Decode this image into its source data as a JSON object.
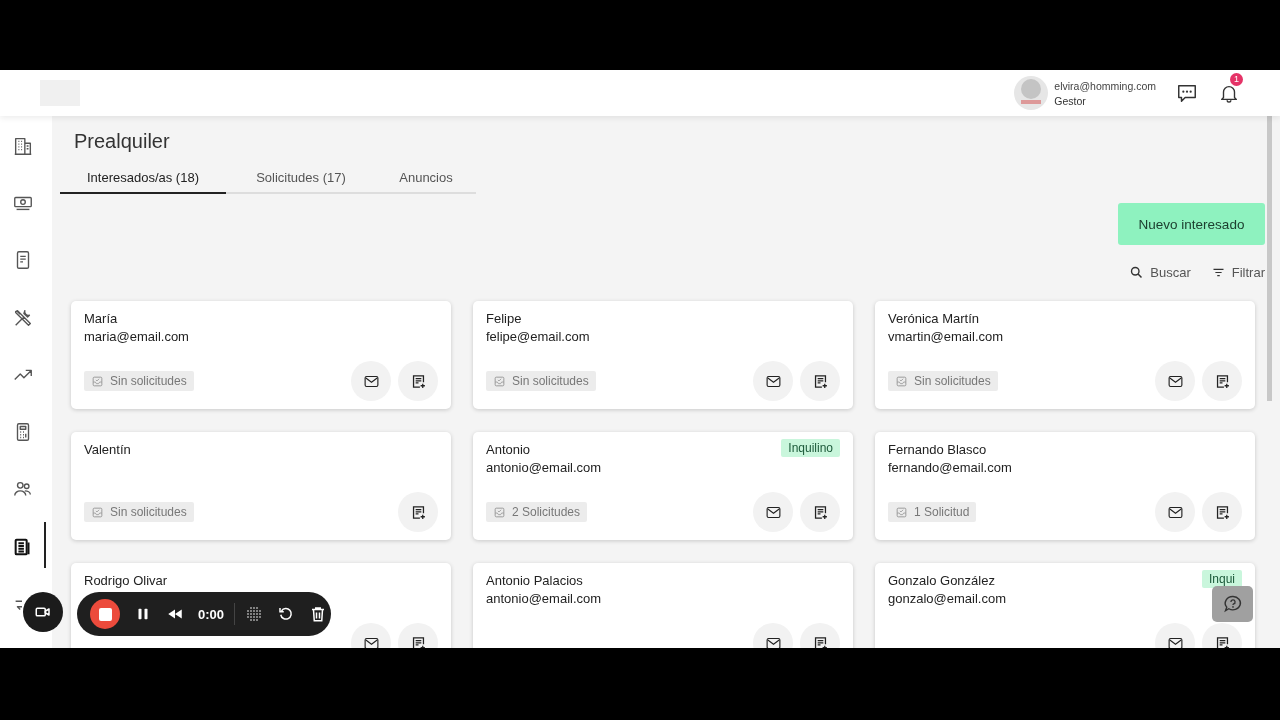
{
  "header": {
    "user_email": "elvira@homming.com",
    "user_role": "Gestor",
    "notification_count": "1"
  },
  "sidebar": {
    "items": [
      {
        "selected": false
      },
      {
        "selected": false
      },
      {
        "selected": false
      },
      {
        "selected": false
      },
      {
        "selected": false
      },
      {
        "selected": false
      },
      {
        "selected": false
      },
      {
        "selected": true
      },
      {
        "selected": false
      }
    ]
  },
  "page": {
    "title": "Prealquiler"
  },
  "tabs": [
    {
      "label": "Interesados/as (18)",
      "selected": true
    },
    {
      "label": "Solicitudes (17)",
      "selected": false
    },
    {
      "label": "Anuncios",
      "selected": false
    }
  ],
  "primary_button": "Nuevo interesado",
  "tools": {
    "search": "Buscar",
    "filter": "Filtrar"
  },
  "cards": [
    {
      "name": "María",
      "email": "maria@email.com",
      "requests": "Sin solicitudes",
      "can_email": true
    },
    {
      "name": "Felipe",
      "email": "felipe@email.com",
      "requests": "Sin solicitudes",
      "can_email": true
    },
    {
      "name": "Verónica Martín",
      "email": "vmartin@email.com",
      "requests": "Sin solicitudes",
      "can_email": true
    },
    {
      "name": "Valentín",
      "requests": "Sin solicitudes",
      "can_email": false
    },
    {
      "name": "Antonio",
      "email": "antonio@email.com",
      "tag": "Inquilino",
      "requests": "2 Solicitudes",
      "can_email": true
    },
    {
      "name": "Fernando Blasco",
      "email": "fernando@email.com",
      "requests": "1 Solicitud",
      "can_email": true
    },
    {
      "name": "Rodrigo Olivar",
      "can_email": true
    },
    {
      "name": "Antonio Palacios",
      "email": "antonio@email.com",
      "can_email": true
    },
    {
      "name": "Gonzalo González",
      "email": "gonzalo@email.com",
      "tag": "Inqui",
      "can_email": true
    }
  ],
  "recorder": {
    "time": "0:00"
  }
}
